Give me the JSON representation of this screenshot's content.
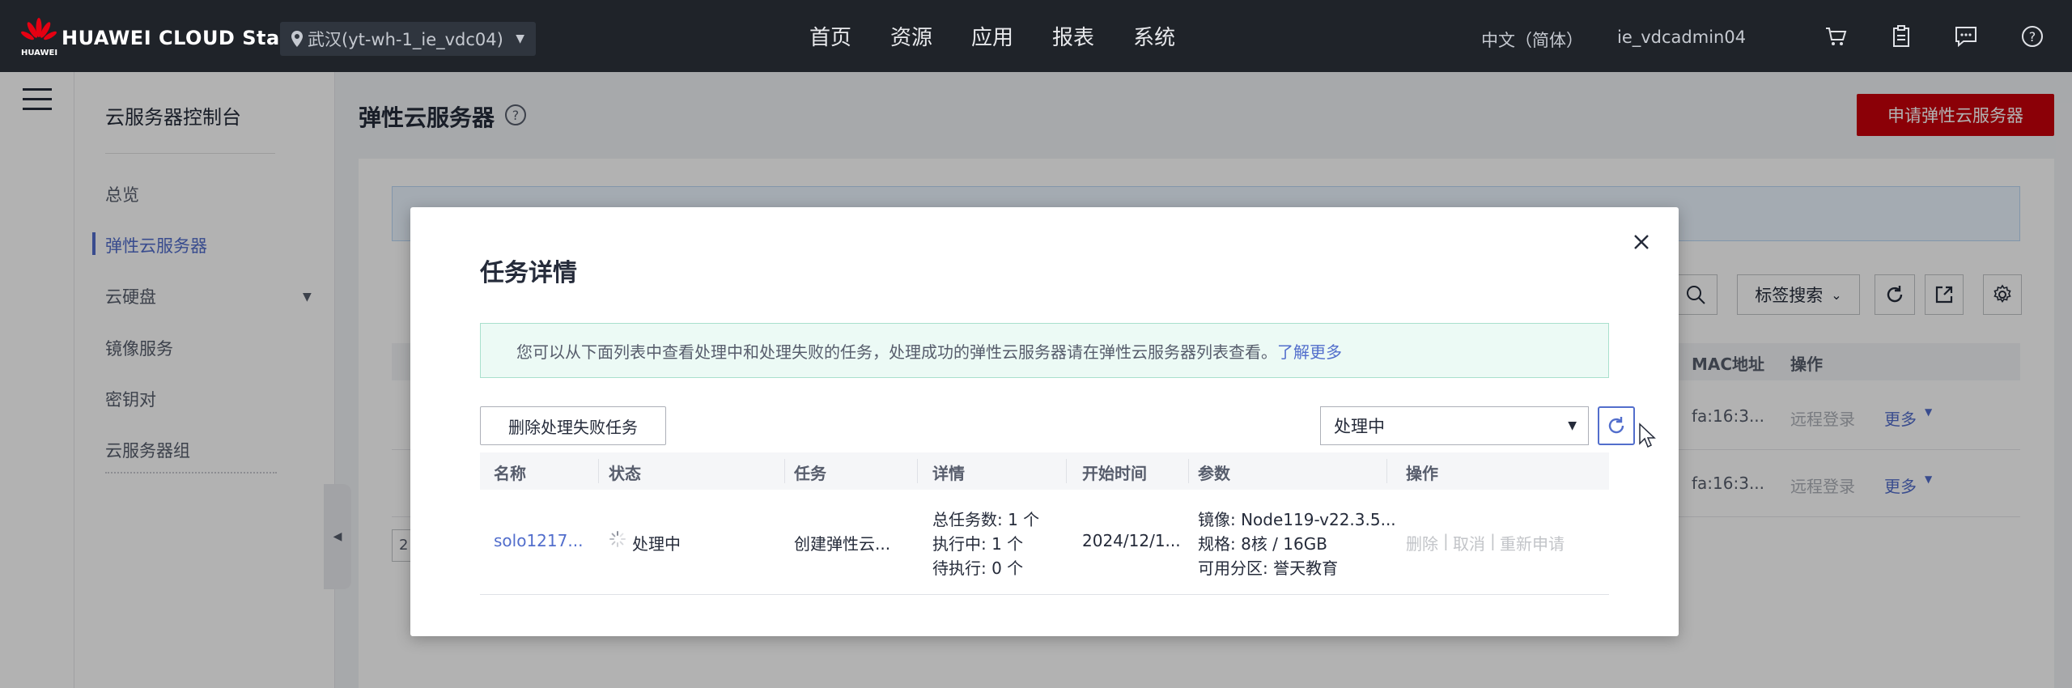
{
  "topbar": {
    "brand": "HUAWEI CLOUD Stack",
    "brand_sub": "HUAWEI",
    "region": "武汉(yt-wh-1_ie_vdc04)",
    "nav": [
      "首页",
      "资源",
      "应用",
      "报表",
      "系统"
    ],
    "language": "中文（简体）",
    "username": "ie_vdcadmin04",
    "icons": [
      "cart-icon",
      "clipboard-icon",
      "message-icon",
      "help-icon"
    ]
  },
  "sidebar": {
    "title": "云服务器控制台",
    "items": [
      {
        "label": "总览",
        "active": false
      },
      {
        "label": "弹性云服务器",
        "active": true
      },
      {
        "label": "云硬盘",
        "active": false,
        "expandable": true
      },
      {
        "label": "镜像服务",
        "active": false
      },
      {
        "label": "密钥对",
        "active": false
      },
      {
        "label": "云服务器组",
        "active": false
      }
    ]
  },
  "main": {
    "title": "弹性云服务器",
    "apply_button": "申请弹性云服务器",
    "tag_search": "标签搜索",
    "background_columns": {
      "mac": "MAC地址",
      "ops": "操作"
    },
    "background_rows": [
      {
        "mac": "fa:16:3...",
        "remote_login": "远程登录",
        "more": "更多"
      },
      {
        "mac": "fa:16:3...",
        "remote_login": "远程登录",
        "more": "更多"
      }
    ],
    "pager_partial": "2"
  },
  "modal": {
    "title": "任务详情",
    "info_text": "您可以从下面列表中查看处理中和处理失败的任务，处理成功的弹性云服务器请在弹性云服务器列表查看。",
    "info_link": "了解更多",
    "delete_failed_button": "删除处理失败任务",
    "status_filter": "处理中",
    "columns": [
      "名称",
      "状态",
      "任务",
      "详情",
      "开始时间",
      "参数",
      "操作"
    ],
    "rows": [
      {
        "name": "solo1217...",
        "status": "处理中",
        "task": "创建弹性云...",
        "details": [
          "总任务数: 1 个",
          "执行中: 1 个",
          "待执行: 0 个"
        ],
        "start_time": "2024/12/1...",
        "params": [
          "镜像: Node119-v22.3.5...",
          "规格: 8核 / 16GB",
          "可用分区: 誉天教育"
        ],
        "actions": [
          "删除",
          "取消",
          "重新申请"
        ]
      }
    ]
  },
  "colors": {
    "topbar_bg": "#1f2329",
    "primary_red": "#c7000b",
    "link_blue": "#526ecc",
    "info_green_bg": "#ecfaf5"
  }
}
